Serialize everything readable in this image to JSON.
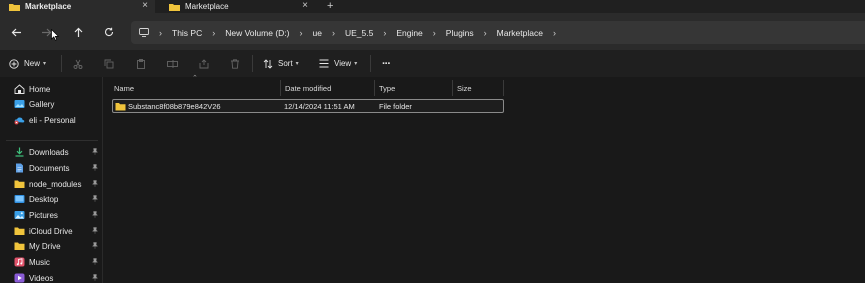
{
  "tabs": [
    {
      "label": "Marketplace",
      "close": "×"
    },
    {
      "label": "Marketplace",
      "close": "×"
    }
  ],
  "new_tab": "+",
  "breadcrumbs": [
    "This PC",
    "New Volume (D:)",
    "ue",
    "UE_5.5",
    "Engine",
    "Plugins",
    "Marketplace"
  ],
  "toolbar": {
    "new_label": "New",
    "sort_label": "Sort",
    "view_label": "View",
    "more": "···"
  },
  "sidebar": {
    "top": [
      {
        "label": "Home",
        "icon": "home-icon"
      },
      {
        "label": "Gallery",
        "icon": "gallery-icon"
      },
      {
        "label": "eli - Personal",
        "icon": "onedrive-icon"
      }
    ],
    "quick": [
      {
        "label": "Downloads",
        "icon": "downloads-icon"
      },
      {
        "label": "Documents",
        "icon": "documents-icon"
      },
      {
        "label": "node_modules",
        "icon": "folder-icon"
      },
      {
        "label": "Desktop",
        "icon": "desktop-icon"
      },
      {
        "label": "Pictures",
        "icon": "pictures-icon"
      },
      {
        "label": "iCloud Drive",
        "icon": "folder-icon"
      },
      {
        "label": "My Drive",
        "icon": "folder-icon"
      },
      {
        "label": "Music",
        "icon": "music-icon"
      },
      {
        "label": "Videos",
        "icon": "videos-icon"
      }
    ]
  },
  "columns": {
    "name": "Name",
    "date": "Date modified",
    "type": "Type",
    "size": "Size"
  },
  "files": [
    {
      "name": "Substanc8f08b879e842V26",
      "date": "12/14/2024 11:51 AM",
      "type": "File folder",
      "size": ""
    }
  ],
  "colors": {
    "folder": "#f0c43c",
    "accent": "#4cc2ff"
  }
}
